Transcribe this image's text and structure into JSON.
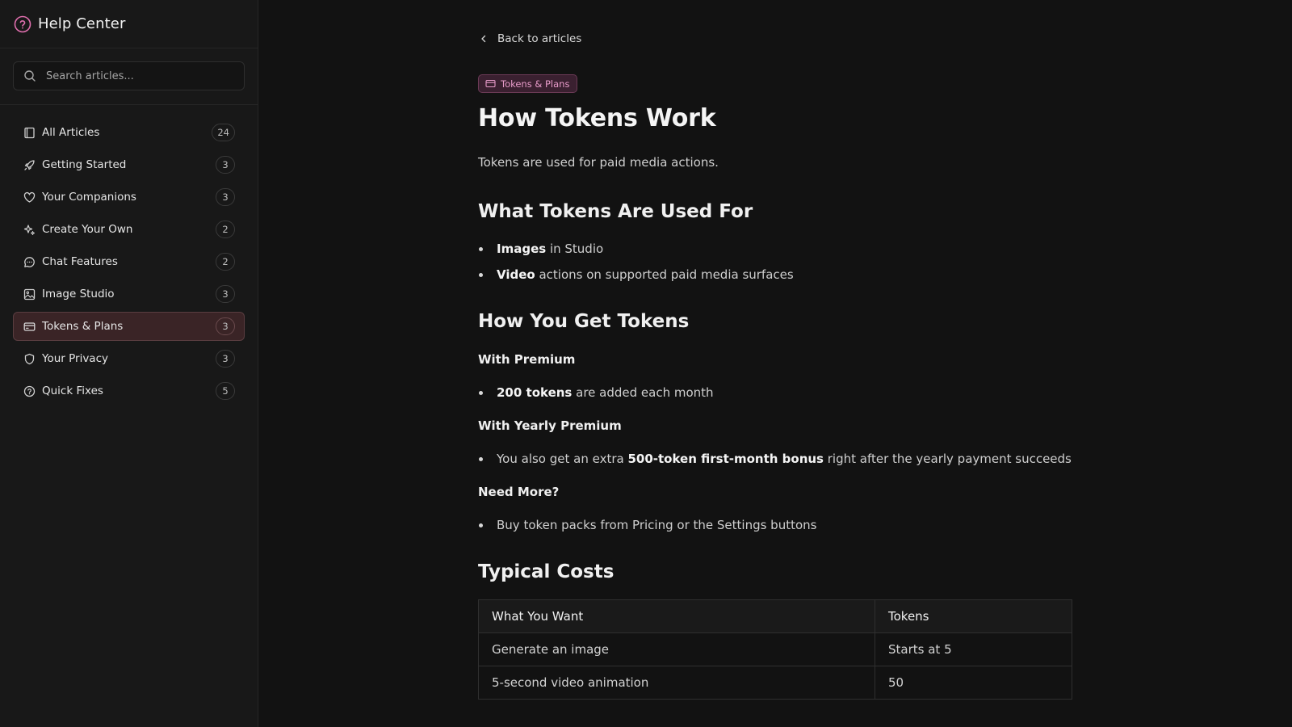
{
  "sidebar": {
    "title": "Help Center",
    "search_placeholder": "Search articles...",
    "items": [
      {
        "label": "All Articles",
        "count": "24",
        "icon": "book-icon"
      },
      {
        "label": "Getting Started",
        "count": "3",
        "icon": "rocket-icon"
      },
      {
        "label": "Your Companions",
        "count": "3",
        "icon": "heart-icon"
      },
      {
        "label": "Create Your Own",
        "count": "2",
        "icon": "sparkles-icon"
      },
      {
        "label": "Chat Features",
        "count": "2",
        "icon": "chat-bubble-icon"
      },
      {
        "label": "Image Studio",
        "count": "3",
        "icon": "image-icon"
      },
      {
        "label": "Tokens & Plans",
        "count": "3",
        "icon": "credit-card-icon",
        "active": true
      },
      {
        "label": "Your Privacy",
        "count": "3",
        "icon": "shield-icon"
      },
      {
        "label": "Quick Fixes",
        "count": "5",
        "icon": "help-circle-icon"
      }
    ]
  },
  "article": {
    "back_label": "Back to articles",
    "tag": "Tokens & Plans",
    "title": "How Tokens Work",
    "intro": "Tokens are used for paid media actions.",
    "section1": {
      "heading": "What Tokens Are Used For",
      "b1_bold": "Images",
      "b1_rest": " in Studio",
      "b2_bold": "Video",
      "b2_rest": " actions on supported paid media surfaces"
    },
    "section2": {
      "heading": "How You Get Tokens",
      "premium_heading": "With Premium",
      "premium_bold": "200 tokens",
      "premium_rest": " are added each month",
      "yearly_heading": "With Yearly Premium",
      "yearly_pre": "You also get an extra ",
      "yearly_bold": "500-token first-month bonus",
      "yearly_rest": " right after the yearly payment succeeds",
      "more_heading": "Need More?",
      "more_text": "Buy token packs from Pricing or the Settings buttons"
    },
    "section3": {
      "heading": "Typical Costs",
      "columns": [
        "What You Want",
        "Tokens"
      ],
      "rows": [
        [
          "Generate an image",
          "Starts at 5"
        ],
        [
          "5-second video animation",
          "50"
        ]
      ]
    }
  },
  "colors": {
    "accent_pink": "#e79bc9",
    "active_bg": "#3a2426",
    "background": "#121212",
    "sidebar_bg": "#181818"
  }
}
